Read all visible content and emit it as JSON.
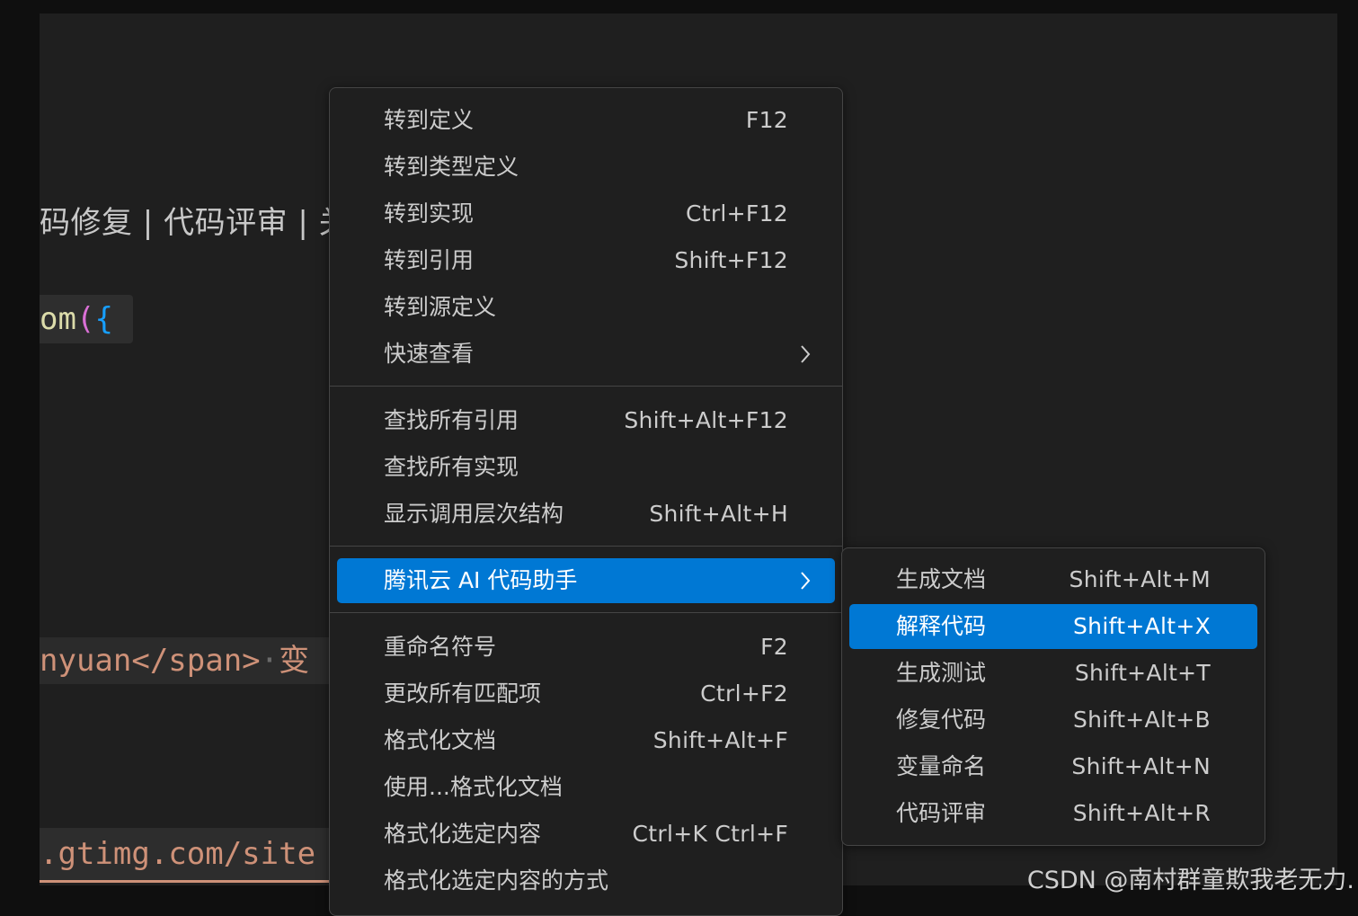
{
  "editor": {
    "doc_links": "码修复 | 代码评审 | 关",
    "code_line1": {
      "ident": "om",
      "paren": "(",
      "brace": "{"
    },
    "code_line2": {
      "text": "nyuan</span>",
      "dot": "·",
      "zh": "变"
    },
    "code_line3": ".gtimg.com/site"
  },
  "context_menu": {
    "group1": [
      {
        "label": "转到定义",
        "key": "F12"
      },
      {
        "label": "转到类型定义",
        "key": ""
      },
      {
        "label": "转到实现",
        "key": "Ctrl+F12"
      },
      {
        "label": "转到引用",
        "key": "Shift+F12"
      },
      {
        "label": "转到源定义",
        "key": ""
      },
      {
        "label": "快速查看",
        "key": "",
        "icon": "chevron-right-icon"
      }
    ],
    "group2": [
      {
        "label": "查找所有引用",
        "key": "Shift+Alt+F12"
      },
      {
        "label": "查找所有实现",
        "key": ""
      },
      {
        "label": "显示调用层次结构",
        "key": "Shift+Alt+H"
      }
    ],
    "group3": [
      {
        "label": "腾讯云 AI 代码助手",
        "key": "",
        "icon": "chevron-right-icon",
        "active": true
      }
    ],
    "group4": [
      {
        "label": "重命名符号",
        "key": "F2"
      },
      {
        "label": "更改所有匹配项",
        "key": "Ctrl+F2"
      },
      {
        "label": "格式化文档",
        "key": "Shift+Alt+F"
      },
      {
        "label": "使用...格式化文档",
        "key": ""
      },
      {
        "label": "格式化选定内容",
        "key": "Ctrl+K Ctrl+F"
      },
      {
        "label": "格式化选定内容的方式",
        "key": ""
      }
    ]
  },
  "submenu": [
    {
      "label": "生成文档",
      "key": "Shift+Alt+M"
    },
    {
      "label": "解释代码",
      "key": "Shift+Alt+X",
      "active": true
    },
    {
      "label": "生成测试",
      "key": "Shift+Alt+T"
    },
    {
      "label": "修复代码",
      "key": "Shift+Alt+B"
    },
    {
      "label": "变量命名",
      "key": "Shift+Alt+N"
    },
    {
      "label": "代码评审",
      "key": "Shift+Alt+R"
    }
  ],
  "watermark": "CSDN @南村群童欺我老无力.",
  "colors": {
    "accent": "#0078d4",
    "menu_bg": "#1f1f1f",
    "menu_border": "#454545",
    "text": "#cccccc"
  }
}
